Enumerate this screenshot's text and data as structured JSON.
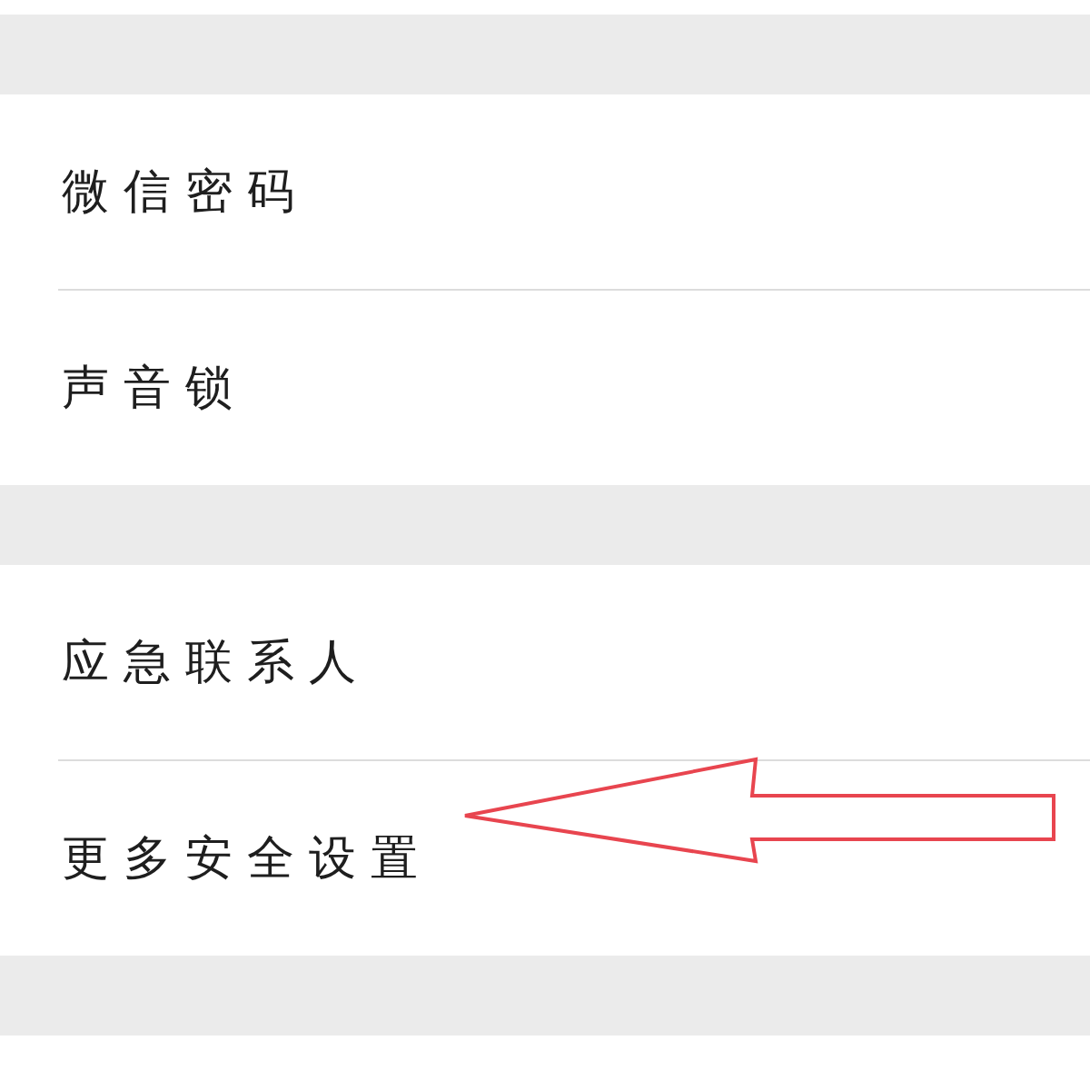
{
  "groups": [
    {
      "items": [
        {
          "label": "微信密码",
          "pointed": false
        },
        {
          "label": "声音锁",
          "pointed": false
        }
      ]
    },
    {
      "items": [
        {
          "label": "应急联系人",
          "pointed": false
        },
        {
          "label": "更多安全设置",
          "pointed": true
        }
      ]
    }
  ]
}
